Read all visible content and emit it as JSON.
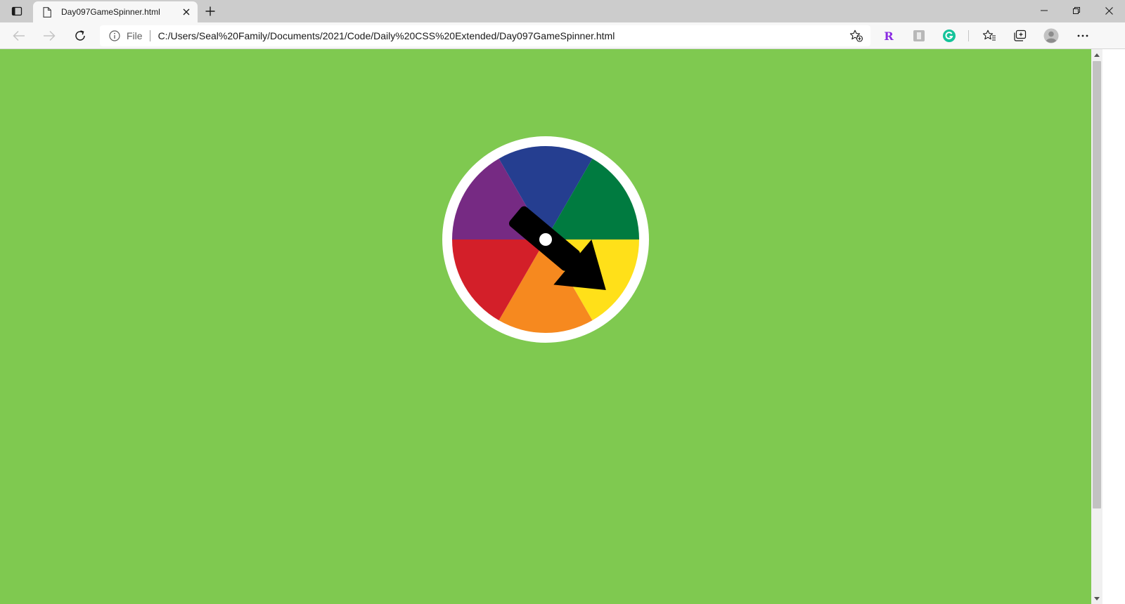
{
  "browser": {
    "tab": {
      "title": "Day097GameSpinner.html"
    },
    "address": {
      "scheme_label": "File",
      "url": "C:/Users/Seal%20Family/Documents/2021/Code/Daily%20CSS%20Extended/Day097GameSpinner.html"
    },
    "extensions": [
      {
        "icon": "r-extension-icon",
        "glyph": "R",
        "color": "#8a2be2"
      },
      {
        "icon": "puzzle-extension-icon",
        "glyph": "⬚",
        "color": "#9a9a9a"
      },
      {
        "icon": "grammarly-icon",
        "glyph": "G",
        "color": "#15c39a"
      }
    ]
  },
  "page": {
    "background_color": "#7fc950",
    "spinner": {
      "rim_color": "#ffffff",
      "segments": [
        {
          "name": "blue",
          "color": "#253e90"
        },
        {
          "name": "green",
          "color": "#007b40"
        },
        {
          "name": "yellow",
          "color": "#ffe019"
        },
        {
          "name": "orange",
          "color": "#f6891f"
        },
        {
          "name": "red",
          "color": "#d31f29"
        },
        {
          "name": "purple",
          "color": "#762a83"
        }
      ],
      "pointer_color": "#000000",
      "hub_color": "#ffffff"
    }
  }
}
